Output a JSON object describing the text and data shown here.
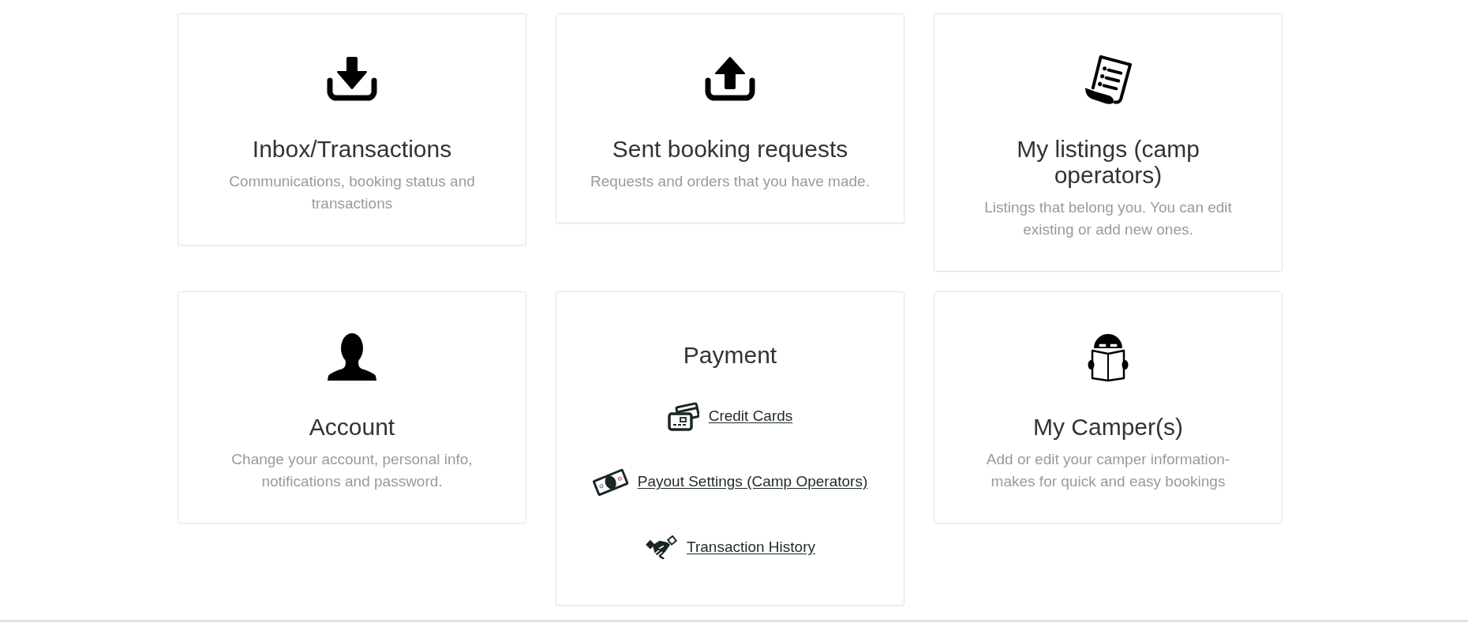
{
  "cards": [
    {
      "kind": "feature",
      "title": "Inbox/Transactions",
      "description": "Communications, booking status and transactions"
    },
    {
      "kind": "feature",
      "title": "Sent booking requests",
      "description": "Requests and orders that you have made."
    },
    {
      "kind": "feature",
      "title": "My listings (camp operators)",
      "description": "Listings that belong you. You can edit existing or add new ones."
    },
    {
      "kind": "feature",
      "title": "Account",
      "description": "Change your account, personal info, notifications and password."
    },
    {
      "kind": "links",
      "title": "Payment",
      "links": [
        {
          "label": "Credit Cards"
        },
        {
          "label": "Payout Settings (Camp Operators)"
        },
        {
          "label": "Transaction History"
        }
      ]
    },
    {
      "kind": "feature",
      "title": "My Camper(s)",
      "description": "Add or edit your camper information-makes for quick and easy bookings"
    }
  ]
}
